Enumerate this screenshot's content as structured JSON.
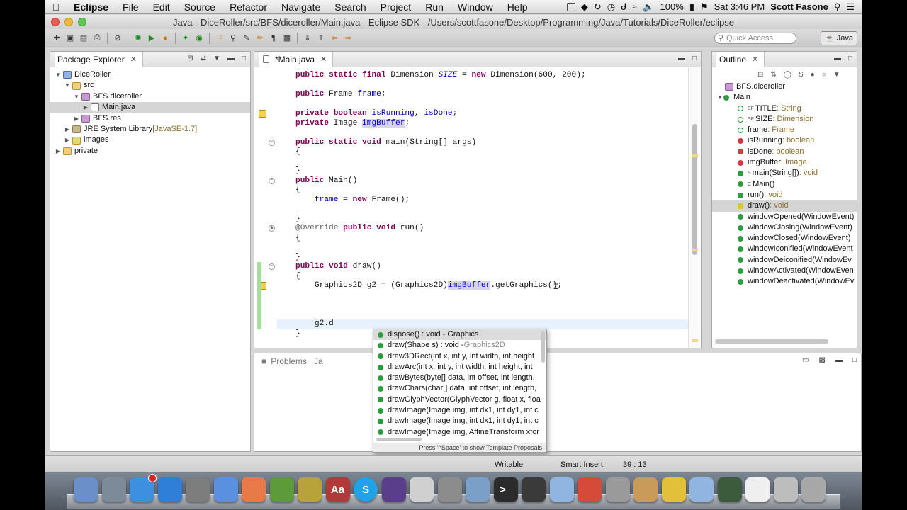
{
  "menubar": {
    "app_name": "Eclipse",
    "items": [
      "File",
      "Edit",
      "Source",
      "Refactor",
      "Navigate",
      "Search",
      "Project",
      "Run",
      "Window",
      "Help"
    ],
    "battery": "100%",
    "clock": "Sat 3:46 PM",
    "user": "Scott Fasone"
  },
  "window": {
    "title": "Java - DiceRoller/src/BFS/diceroller/Main.java - Eclipse SDK - /Users/scottfasone/Desktop/Programming/Java/Tutorials/DiceRoller/eclipse"
  },
  "toolbar": {
    "quick_access_placeholder": "Quick Access",
    "perspective": "Java"
  },
  "package_explorer": {
    "title": "Package Explorer",
    "tree": [
      {
        "label": "DiceRoller",
        "depth": 0,
        "icon": "project-icon",
        "twisty": "open"
      },
      {
        "label": "src",
        "depth": 1,
        "icon": "source-folder-icon",
        "twisty": "open"
      },
      {
        "label": "BFS.diceroller",
        "depth": 2,
        "icon": "package-icon",
        "twisty": "open"
      },
      {
        "label": "Main.java",
        "depth": 3,
        "icon": "java-file-icon",
        "twisty": "closed",
        "selected": true
      },
      {
        "label": "BFS.res",
        "depth": 2,
        "icon": "package-icon",
        "twisty": "closed"
      },
      {
        "label": "JRE System Library",
        "suffix": "[JavaSE-1.7]",
        "depth": 1,
        "icon": "library-icon",
        "twisty": "closed"
      },
      {
        "label": "images",
        "depth": 1,
        "icon": "folder-icon",
        "twisty": "closed"
      },
      {
        "label": "private",
        "depth": 0,
        "icon": "folder-icon",
        "twisty": "closed"
      }
    ]
  },
  "editor": {
    "tab_title": "*Main.java",
    "lines": [
      "public static final Dimension SIZE = new Dimension(600, 200);",
      "",
      "public Frame frame;",
      "",
      "private boolean isRunning, isDone;",
      "private Image imgBuffer;",
      "",
      "public static void main(String[] args)",
      "{",
      "",
      "}",
      "public Main()",
      "{",
      "    frame = new Frame();",
      "",
      "}",
      "@Override public void run()",
      "{",
      "",
      "}",
      "public void draw()",
      "{",
      "    Graphics2D g2 = (Graphics2D)imgBuffer.getGraphics();",
      "",
      "",
      "",
      "    g2.d",
      "}"
    ]
  },
  "content_assist": {
    "proposals": [
      {
        "text": "dispose() : void - Graphics",
        "selected": true
      },
      {
        "text": "draw(Shape s) : void - ",
        "type": "Graphics2D"
      },
      {
        "text": "draw3DRect(int x, int y, int width, int height"
      },
      {
        "text": "drawArc(int x, int y, int width, int height, int"
      },
      {
        "text": "drawBytes(byte[] data, int offset, int length,"
      },
      {
        "text": "drawChars(char[] data, int offset, int length,"
      },
      {
        "text": "drawGlyphVector(GlyphVector g, float x, floa"
      },
      {
        "text": "drawImage(Image img, int dx1, int dy1, int c"
      },
      {
        "text": "drawImage(Image img, int dx1, int dy1, int c"
      },
      {
        "text": "drawImage(Image img, AffineTransform xfor"
      }
    ],
    "footer": "Press '^Space' to show Template Proposals"
  },
  "bottom_panel": {
    "tab_problems": "Problems",
    "tab_partial": "Ja"
  },
  "outline": {
    "title": "Outline",
    "items": [
      {
        "label": "BFS.diceroller",
        "type": "",
        "depth": 0,
        "icon": "package-icon",
        "marker": ""
      },
      {
        "label": "Main",
        "type": "",
        "depth": 0,
        "icon": "class-icon",
        "marker": "",
        "twisty": "open"
      },
      {
        "label": "TITLE",
        "type": " : String",
        "depth": 1,
        "icon": "field-icon",
        "marker": "SF"
      },
      {
        "label": "SIZE",
        "type": " : Dimension",
        "depth": 1,
        "icon": "field-icon",
        "marker": "SF"
      },
      {
        "label": "frame",
        "type": " : Frame",
        "depth": 1,
        "icon": "field-icon",
        "marker": ""
      },
      {
        "label": "isRunning",
        "type": " : boolean",
        "depth": 1,
        "icon": "field-icon",
        "marker": ""
      },
      {
        "label": "isDone",
        "type": " : boolean",
        "depth": 1,
        "icon": "field-icon",
        "marker": ""
      },
      {
        "label": "imgBuffer",
        "type": " : Image",
        "depth": 1,
        "icon": "field-icon",
        "marker": ""
      },
      {
        "label": "main(String[])",
        "type": " : void",
        "depth": 1,
        "icon": "method-icon",
        "marker": "S"
      },
      {
        "label": "Main()",
        "type": "",
        "depth": 1,
        "icon": "method-icon",
        "marker": "C"
      },
      {
        "label": "run()",
        "type": " : void",
        "depth": 1,
        "icon": "method-icon",
        "marker": ""
      },
      {
        "label": "draw()",
        "type": " : void",
        "depth": 1,
        "icon": "method-icon",
        "marker": "",
        "selected": true
      },
      {
        "label": "windowOpened(WindowEvent)",
        "type": "",
        "depth": 1,
        "icon": "method-icon",
        "marker": ""
      },
      {
        "label": "windowClosing(WindowEvent)",
        "type": "",
        "depth": 1,
        "icon": "method-icon",
        "marker": ""
      },
      {
        "label": "windowClosed(WindowEvent)",
        "type": "",
        "depth": 1,
        "icon": "method-icon",
        "marker": ""
      },
      {
        "label": "windowIconified(WindowEvent",
        "type": "",
        "depth": 1,
        "icon": "method-icon",
        "marker": ""
      },
      {
        "label": "windowDeiconified(WindowEv",
        "type": "",
        "depth": 1,
        "icon": "method-icon",
        "marker": ""
      },
      {
        "label": "windowActivated(WindowEven",
        "type": "",
        "depth": 1,
        "icon": "method-icon",
        "marker": ""
      },
      {
        "label": "windowDeactivated(WindowEv",
        "type": "",
        "depth": 1,
        "icon": "method-icon",
        "marker": ""
      }
    ]
  },
  "status": {
    "writable": "Writable",
    "insert_mode": "Smart Insert",
    "position": "39 : 13"
  },
  "dock": {
    "icons": [
      "finder-icon",
      "launchpad-icon",
      "app-store-icon",
      "safari-icon",
      "system-preferences-icon",
      "itunes-icon",
      "color-picker-icon",
      "minecraft-icon",
      "game-icon",
      "dictionary-icon",
      "skype-icon",
      "eclipse-icon",
      "preview-icon",
      "automator-icon",
      "photo-icon",
      "terminal-icon",
      "movie-icon",
      "folder-icon",
      "flash-icon",
      "calculator-icon",
      "cargo-icon",
      "adium-icon",
      "folder-icon",
      "activity-monitor-icon",
      "document-icon",
      "printer-icon",
      "trash-icon"
    ]
  }
}
